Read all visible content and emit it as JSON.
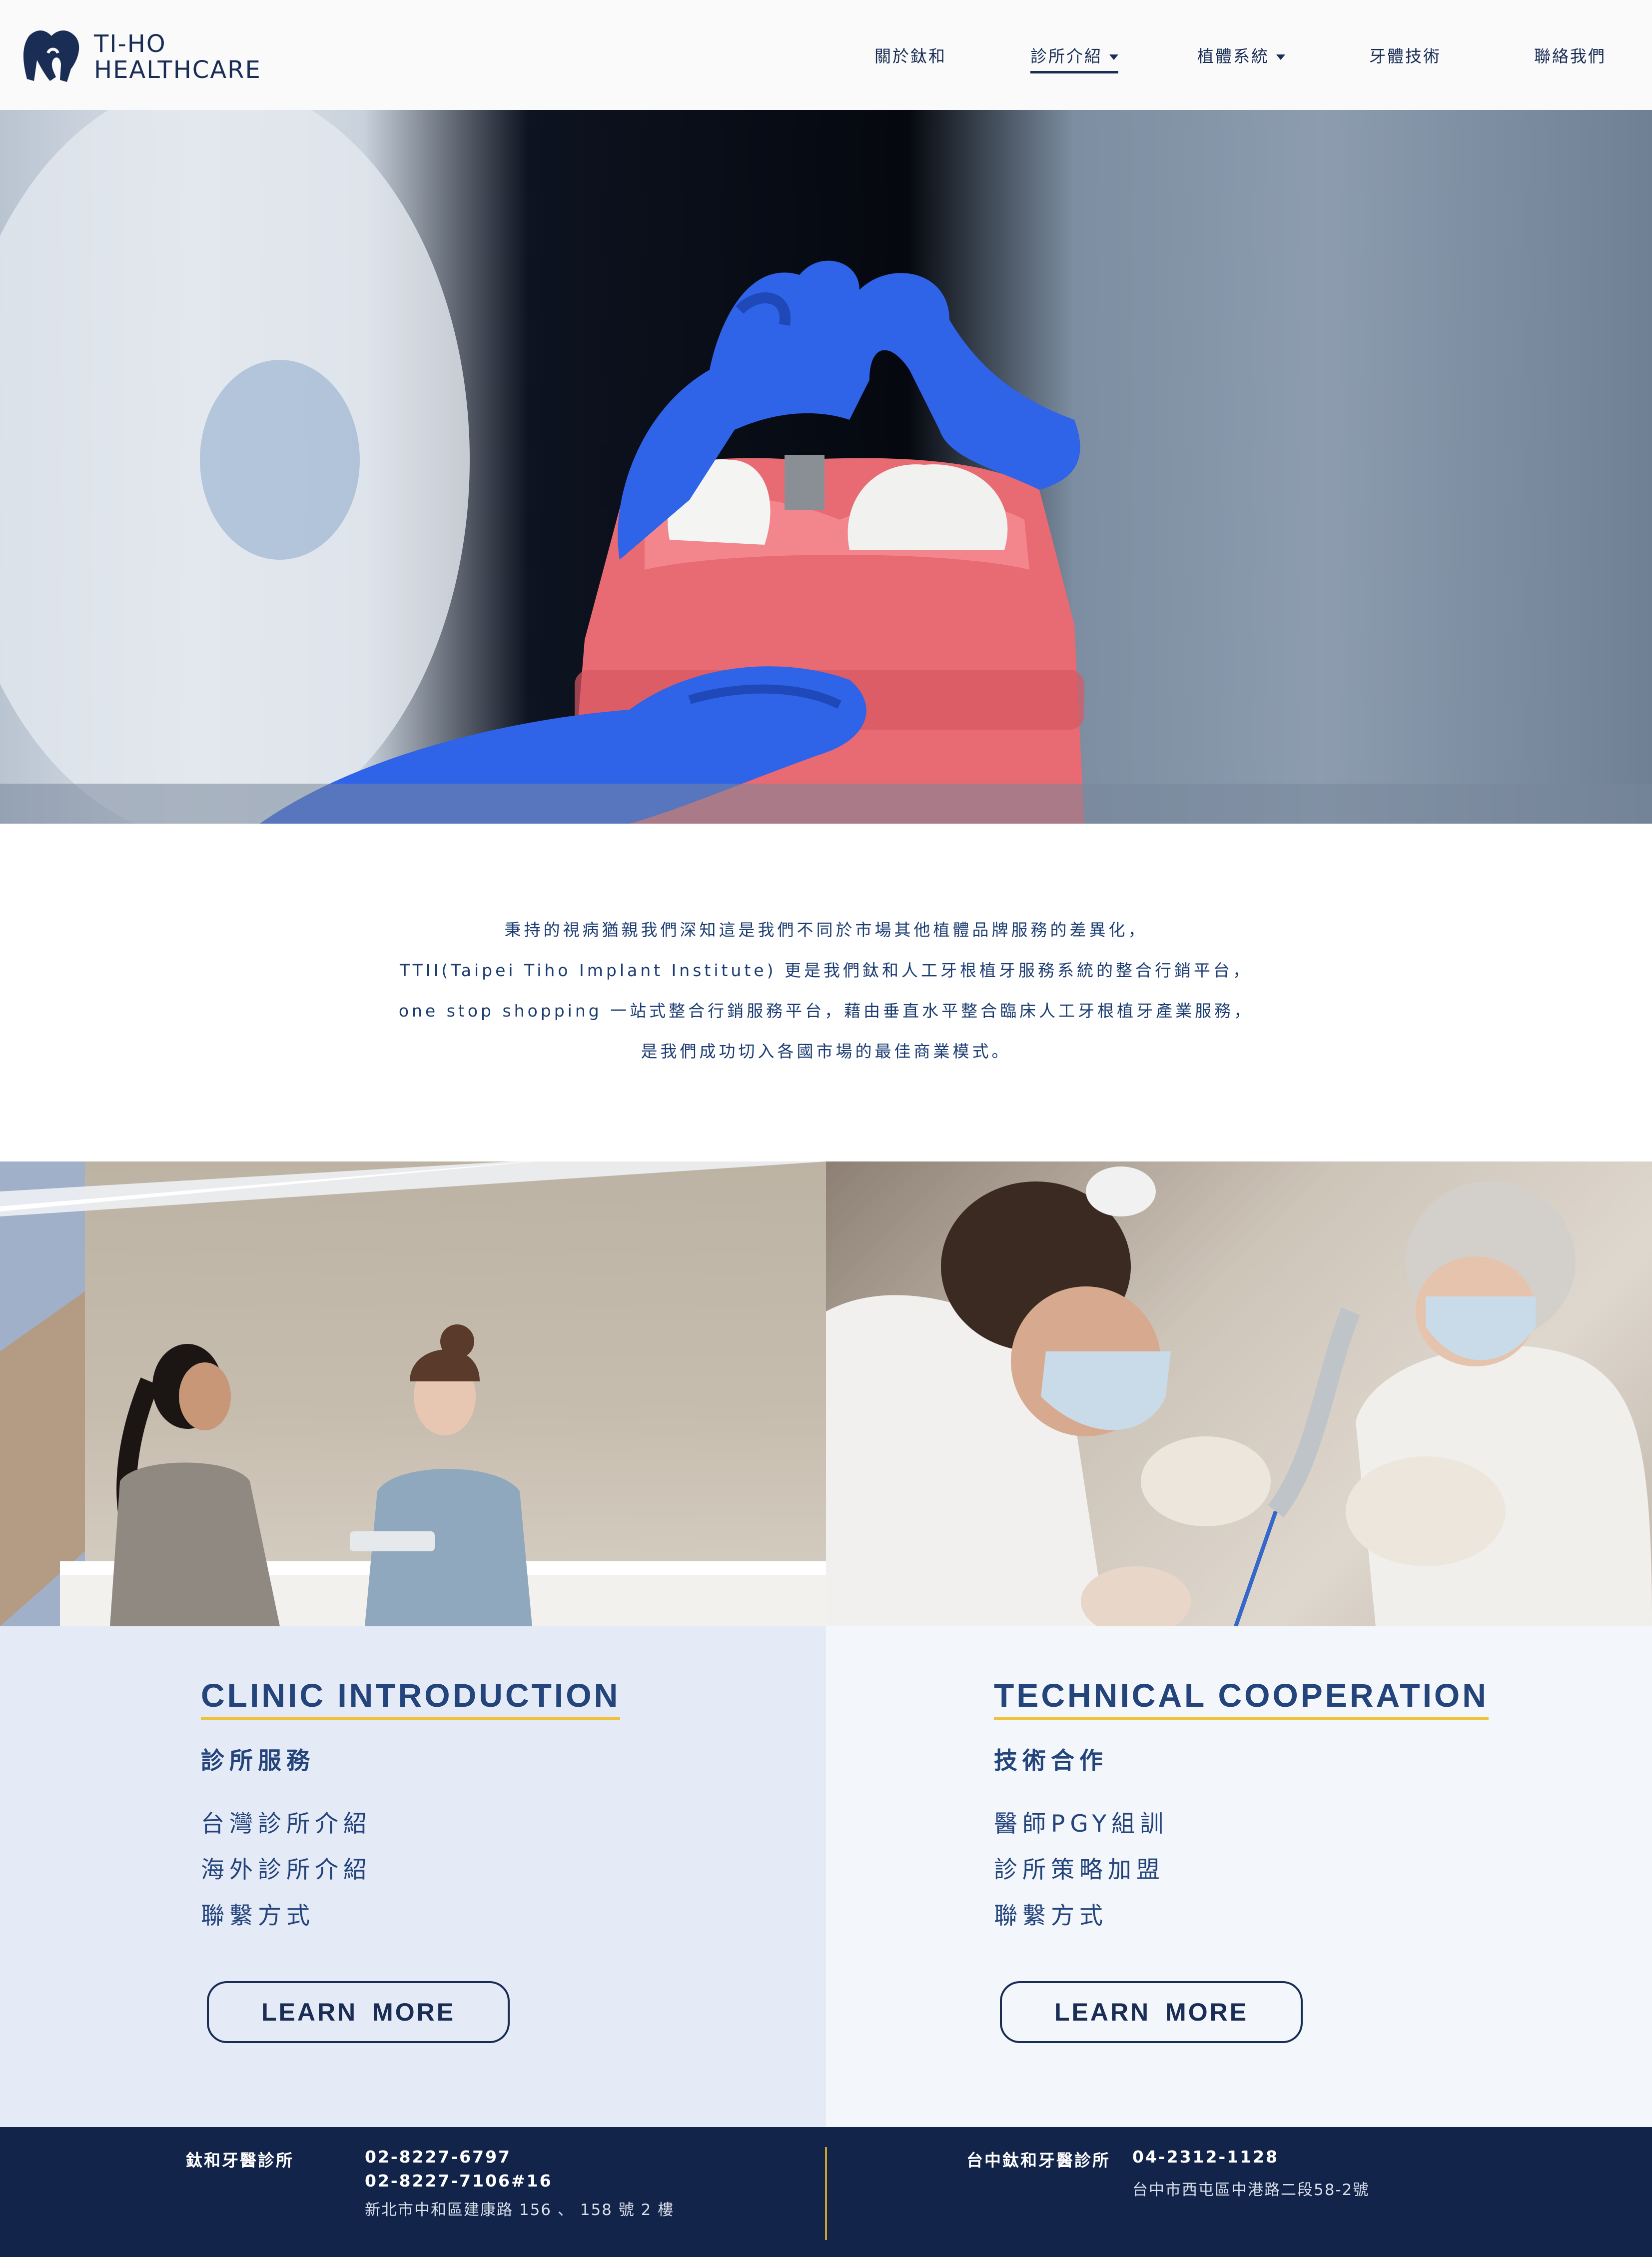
{
  "brand": {
    "line1": "TI-HO",
    "line2": "HEALTHCARE"
  },
  "nav": {
    "about": "關於鈦和",
    "clinic": "診所介紹",
    "implant": "植體系統",
    "tech": "牙體技術",
    "contact": "聯絡我們"
  },
  "intro": {
    "line1": "秉持的視病猶親我們深知這是我們不同於市場其他植體品牌服務的差異化，",
    "line2": "TTII(Taipei Tiho Implant Institute) 更是我們鈦和人工牙根植牙服務系統的整合行銷平台，",
    "line3": "one stop shopping 一站式整合行銷服務平台，藉由垂直水平整合臨床人工牙根植牙產業服務，",
    "line4": "是我們成功切入各國市場的最佳商業模式。"
  },
  "clinic": {
    "title": "CLINIC INTRODUCTION",
    "subtitle": "診所服務",
    "items": [
      "台灣診所介紹",
      "海外診所介紹",
      "聯繫方式"
    ],
    "button": "LEARN MORE"
  },
  "technical": {
    "title": "TECHNICAL COOPERATION",
    "subtitle": "技術合作",
    "items": [
      "醫師PGY組訓",
      "診所策略加盟",
      "聯繫方式"
    ],
    "button": "LEARN MORE"
  },
  "footer": {
    "left": {
      "name": "鈦和牙醫診所",
      "phone1": "02-8227-6797",
      "phone2": "02-8227-7106#16",
      "address": "新北市中和區建康路 156 、 158 號 2 樓"
    },
    "right": {
      "name": "台中鈦和牙醫診所",
      "phone": "04-2312-1128",
      "address": "台中市西屯區中港路二段58-2號"
    }
  },
  "colors": {
    "brand_navy": "#13244a",
    "title_blue": "#24447c",
    "accent_gold": "#f0c23a"
  },
  "icons": {
    "logo": "tooth-logo-icon",
    "dropdown": "chevron-down-icon"
  }
}
